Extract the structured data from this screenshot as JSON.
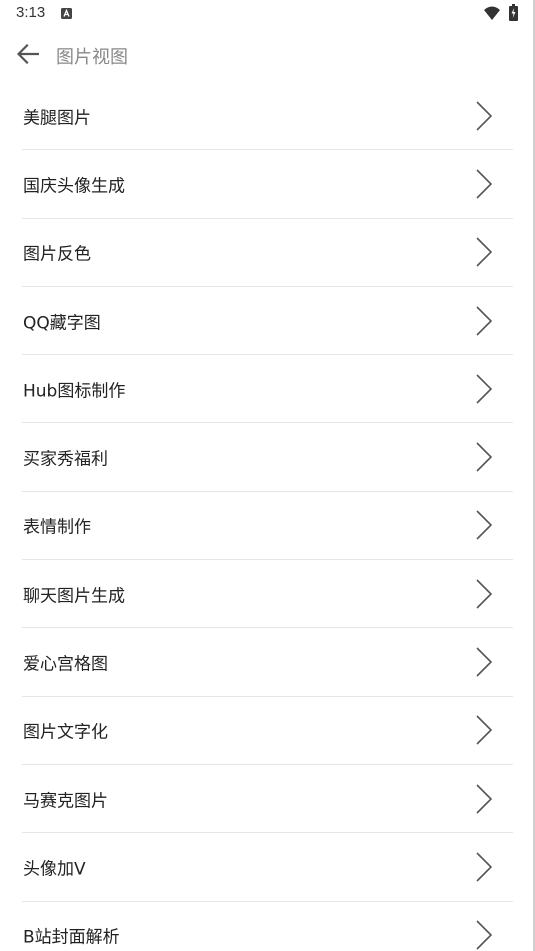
{
  "status_bar": {
    "time": "3:13",
    "icons": [
      "a-notification-icon",
      "wifi-icon",
      "battery-icon"
    ]
  },
  "app_bar": {
    "title": "图片视图",
    "back_icon": "arrow-left-icon"
  },
  "menu": {
    "items": [
      {
        "label": "美腿图片"
      },
      {
        "label": "国庆头像生成"
      },
      {
        "label": "图片反色"
      },
      {
        "label": "QQ藏字图"
      },
      {
        "label": "Hub图标制作"
      },
      {
        "label": "买家秀福利"
      },
      {
        "label": "表情制作"
      },
      {
        "label": "聊天图片生成"
      },
      {
        "label": "爱心宫格图"
      },
      {
        "label": "图片文字化"
      },
      {
        "label": "马赛克图片"
      },
      {
        "label": "头像加V"
      },
      {
        "label": "B站封面解析"
      }
    ],
    "item_icon": "chevron-right-icon"
  },
  "colors": {
    "background": "#ffffff",
    "divider": "#e6e6e6",
    "title": "#888888",
    "text": "#222222",
    "chevron": "#555555"
  }
}
